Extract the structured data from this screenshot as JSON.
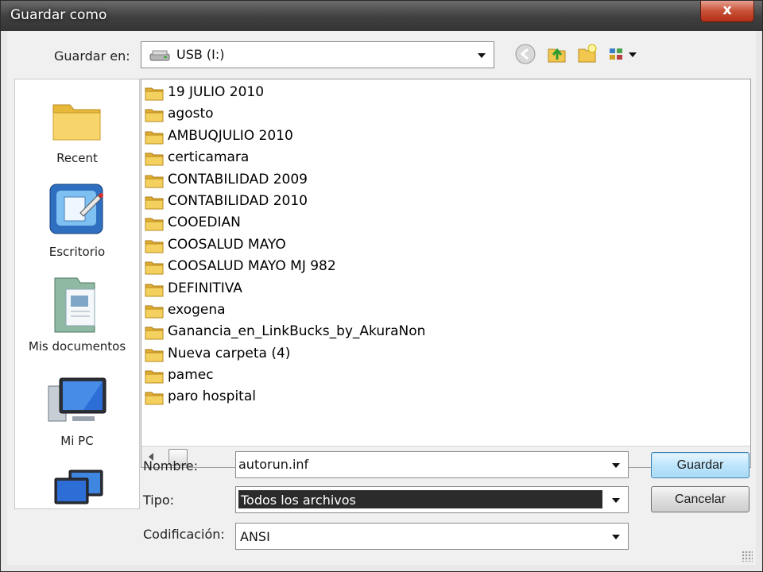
{
  "window": {
    "title": "Guardar como",
    "close_symbol": "x"
  },
  "save_in": {
    "label": "Guardar en:",
    "value": "USB (I:)"
  },
  "toolbar": {
    "icons": [
      "back-icon",
      "up-folder-icon",
      "new-folder-icon",
      "view-menu-icon"
    ]
  },
  "places": [
    {
      "label": "Recent",
      "icon": "recent-folder-icon"
    },
    {
      "label": "Escritorio",
      "icon": "desktop-icon"
    },
    {
      "label": "Mis documentos",
      "icon": "documents-icon"
    },
    {
      "label": "Mi PC",
      "icon": "computer-icon"
    },
    {
      "label": "",
      "icon": "network-icon"
    }
  ],
  "files": [
    "19 JULIO 2010",
    "agosto",
    "AMBUQJULIO 2010",
    "certicamara",
    "CONTABILIDAD 2009",
    "CONTABILIDAD 2010",
    "COOEDIAN",
    "COOSALUD MAYO",
    "COOSALUD MAYO MJ 982",
    "DEFINITIVA",
    "exogena",
    "Ganancia_en_LinkBucks_by_AkuraNon",
    "Nueva carpeta (4)",
    "pamec",
    "paro hospital"
  ],
  "form": {
    "name_label": "Nombre:",
    "name_value": "autorun.inf",
    "type_label": "Tipo:",
    "type_value": "Todos los archivos",
    "encoding_label": "Codificación:",
    "encoding_value": "ANSI"
  },
  "buttons": {
    "save": "Guardar",
    "cancel": "Cancelar"
  },
  "colors": {
    "accent": "#3c7fb1",
    "selection": "#2b2b2b",
    "folder": "#f2cc5a"
  }
}
